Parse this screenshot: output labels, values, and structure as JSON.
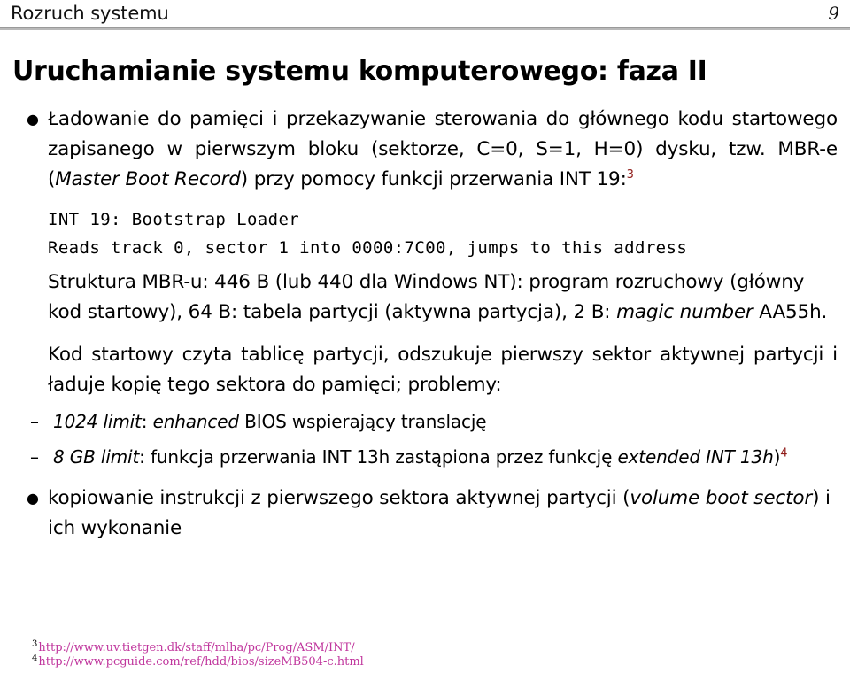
{
  "header": {
    "title": "Rozruch systemu",
    "page_number": "9",
    "rule_color": "#9a9a9a"
  },
  "slide": {
    "title": "Uruchamianie systemu komputerowego: faza II"
  },
  "content": {
    "bullet_marker": "●",
    "dash_marker": "–",
    "items": [
      {
        "type": "bullet",
        "id": "item-ladowanie",
        "text_html": "Ładowanie do pamięci i przekazywanie sterowania do głównego kodu startowego zapisanego w pierwszym bloku (sektorze, C=0, S=1, H=0) dysku, tzw. MBR-e (<i>Master Boot Record</i>) przy pomocy funkcji przerwania INT 19:<span class=\"fn-mark\">3</span>",
        "plain": "Ładowanie do pamięci i przekazywanie sterowania do głównego kodu startowego zapisanego w pierwszym bloku (sektorze, C=0, S=1, H=0) dysku, tzw. MBR-e (Master Boot Record) przy pomocy funkcji przerwania INT 19:3"
      },
      {
        "type": "code",
        "id": "code-int19",
        "lines": [
          "INT 19: Bootstrap Loader",
          "Reads track 0, sector 1 into 0000:7C00, jumps to this address"
        ]
      },
      {
        "type": "plain",
        "id": "item-struktura-mbr",
        "text_html": "Struktura MBR-u: 446 B (lub 440 dla Windows NT): program rozruchowy (główny kod startowy), 64 B: tabela partycji (aktywna partycja), 2 B: <i>magic number</i> AA55h.",
        "plain": "Struktura MBR-u: 446 B (lub 440 dla Windows NT): program rozruchowy (główny kod startowy), 64 B: tabela partycji (aktywna partycja), 2 B: magic number AA55h."
      },
      {
        "type": "plain",
        "id": "item-kod-startowy",
        "text_html": "Kod startowy czyta tablicę partycji, odszukuje pierwszy sektor aktywnej partycji i ładuje kopię tego sektora do pamięci; problemy:",
        "plain": "Kod startowy czyta tablicę partycji, odszukuje pierwszy sektor aktywnej partycji i ładuje kopię tego sektora do pamięci; problemy:"
      },
      {
        "type": "sub",
        "id": "subitem-1024-limit",
        "text_html": "<i>1024 limit</i>: <i>enhanced</i> BIOS wspierający translację",
        "plain": "1024 limit: enhanced BIOS wspierający translację"
      },
      {
        "type": "sub",
        "id": "subitem-8gb-limit",
        "text_html": "<i>8 GB limit</i>: funkcja przerwania INT 13h zastąpiona przez funkcję <i>extended INT 13h</i>)<span class=\"fn-mark\">4</span>",
        "plain": "8 GB limit: funkcja przerwania INT 13h zastąpiona przez funkcję extended INT 13h)4"
      },
      {
        "type": "bullet",
        "id": "item-kopiowanie",
        "text_html": "kopiowanie instrukcji z pierwszego sektora aktywnej partycji (<i>volume boot sector</i>) i ich wykonanie",
        "plain": "kopiowanie instrukcji z pierwszego sektora aktywnej partycji (volume boot sector) i ich wykonanie"
      }
    ]
  },
  "footnotes": {
    "color": "#c0369d",
    "items": [
      {
        "number": "3",
        "url": "http://www.uv.tietgen.dk/staff/mlha/pc/Prog/ASM/INT/"
      },
      {
        "number": "4",
        "url": "http://www.pcguide.com/ref/hdd/bios/sizeMB504-c.html"
      }
    ]
  }
}
